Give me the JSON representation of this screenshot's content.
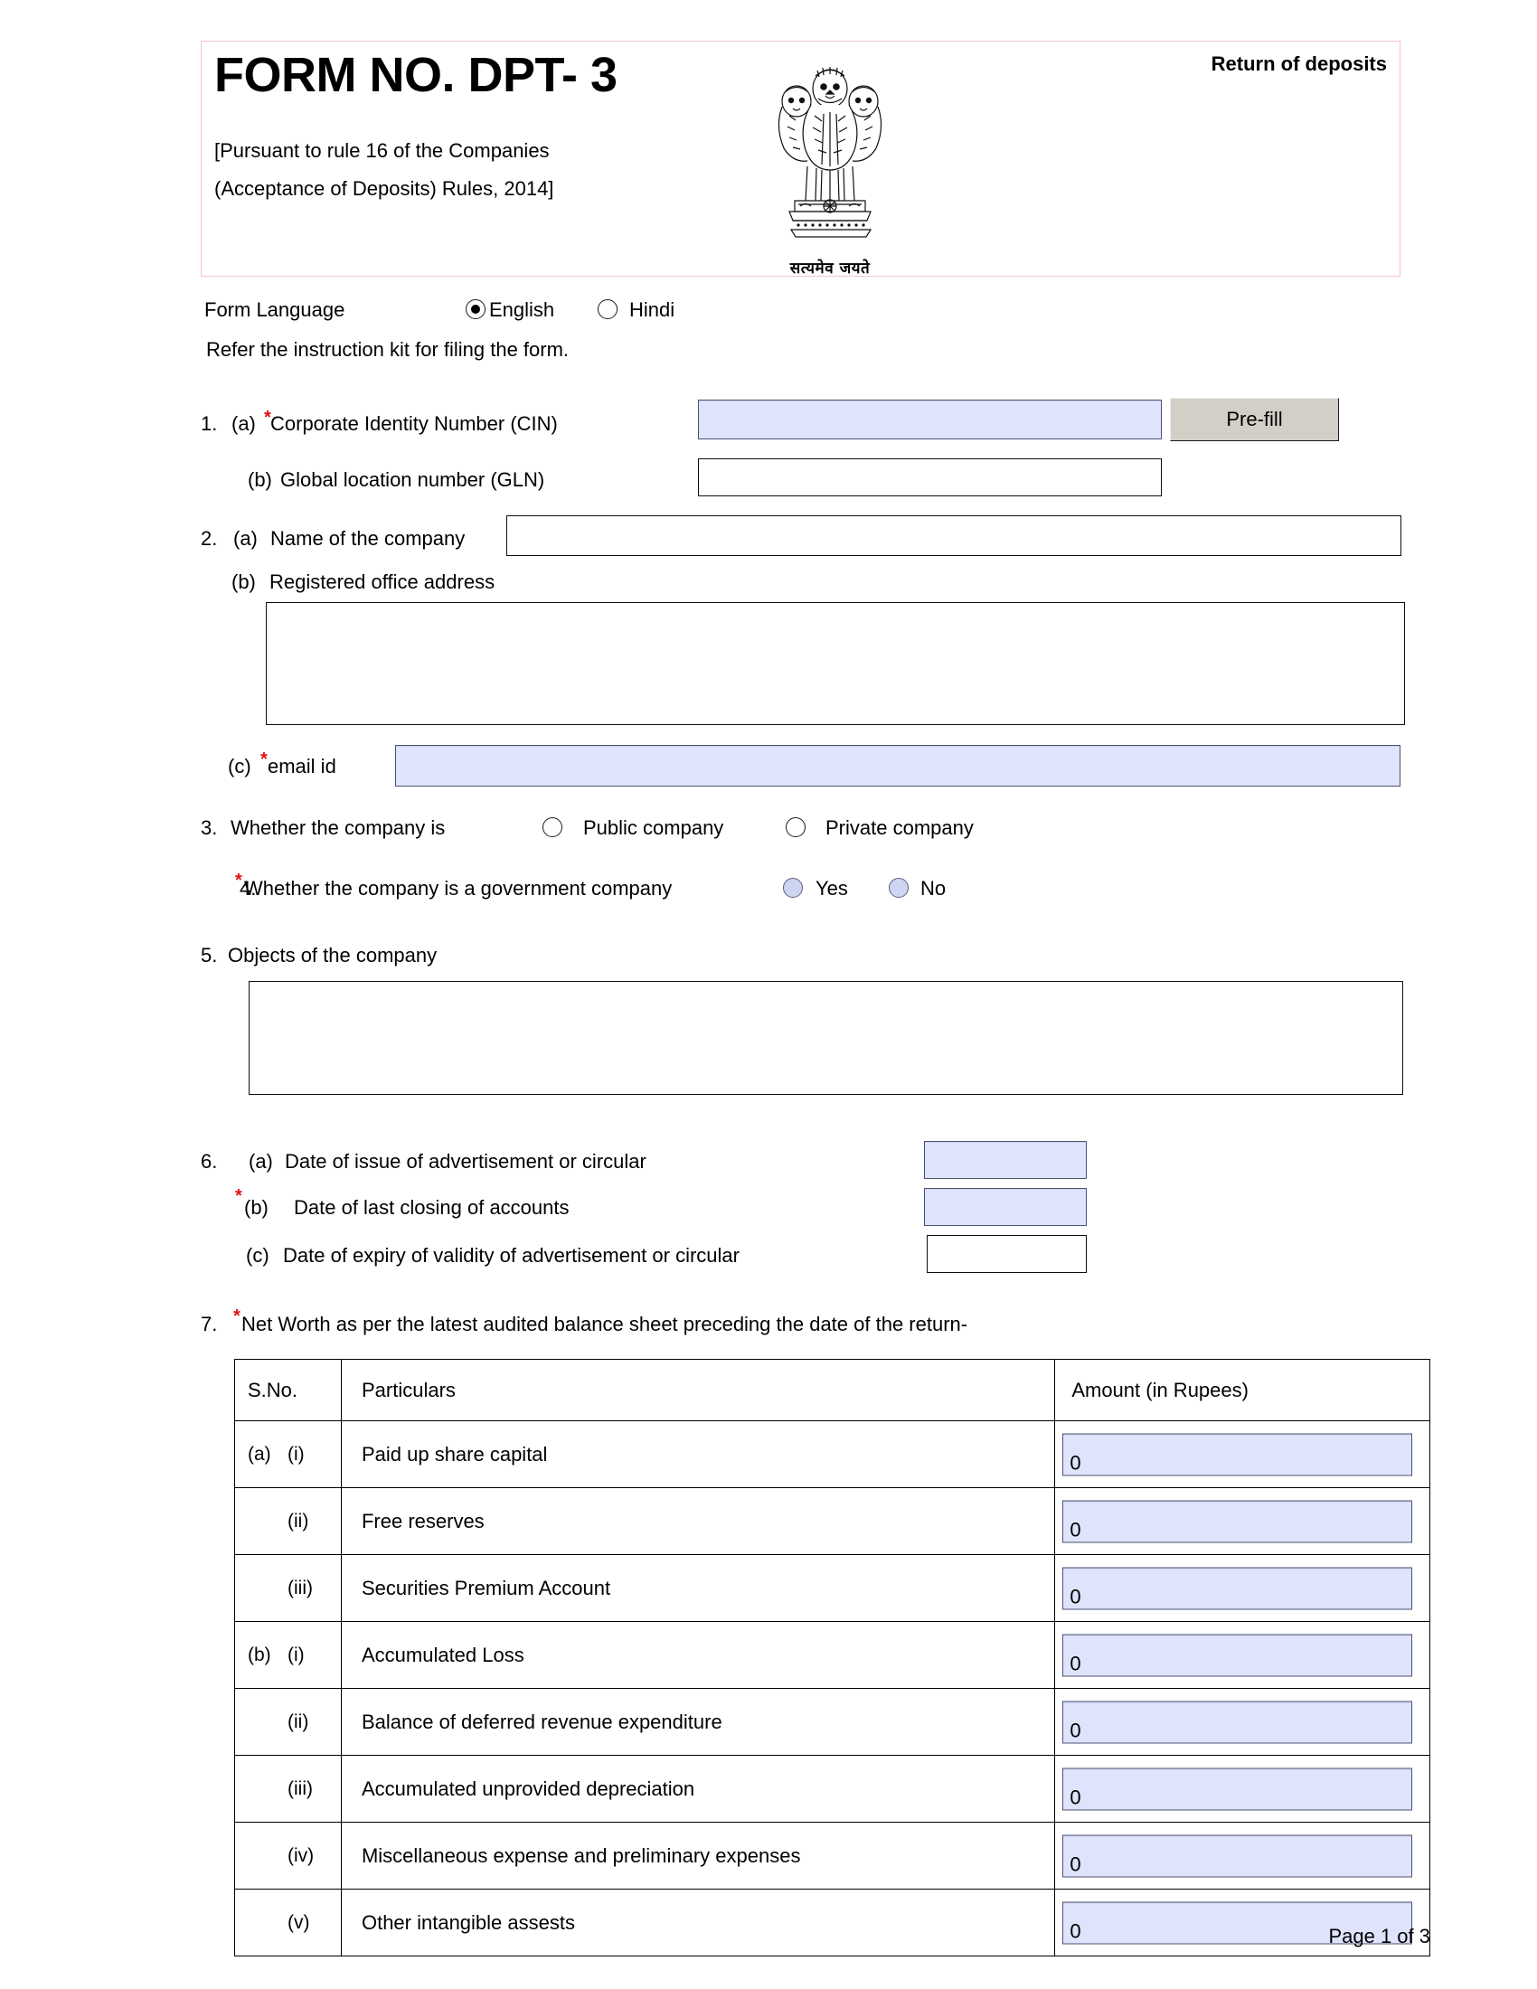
{
  "header": {
    "title": "FORM NO. DPT- 3",
    "rule_line_1": "[Pursuant to rule 16 of the Companies",
    "rule_line_2": "(Acceptance of Deposits) Rules, 2014]",
    "return_label": "Return of deposits",
    "emblem_motto": "सत्यमेव जयते"
  },
  "form_language": {
    "label": "Form Language",
    "option_english": "English",
    "option_hindi": "Hindi",
    "selected": "English",
    "instruction": "Refer the instruction kit for filing the form."
  },
  "item1": {
    "number": "1.",
    "a_prefix": "(a)",
    "a_label": "Corporate Identity Number (CIN)",
    "a_value": "",
    "b_prefix": "(b)",
    "b_label": "Global location number (GLN)",
    "b_value": "",
    "prefill_button": "Pre-fill"
  },
  "item2": {
    "number": "2.",
    "a_prefix": "(a)",
    "a_label": "Name of the company",
    "a_value": "",
    "b_prefix": "(b)",
    "b_label": "Registered office address",
    "b_value": "",
    "c_prefix": "(c)",
    "c_label": "email id",
    "c_value": ""
  },
  "item3": {
    "number": "3.",
    "label": "Whether the company is",
    "option_public": "Public company",
    "option_private": "Private company",
    "selected": ""
  },
  "item4": {
    "number": "4.",
    "label": "Whether the company is a government company",
    "option_yes": "Yes",
    "option_no": "No",
    "selected": ""
  },
  "item5": {
    "number": "5.",
    "label": "Objects of the company",
    "value": ""
  },
  "item6": {
    "number": "6.",
    "a_prefix": "(a)",
    "a_label": "Date of issue of advertisement or circular",
    "a_value": "",
    "b_prefix": "(b)",
    "b_label": "Date of last closing of accounts",
    "b_value": "",
    "c_prefix": "(c)",
    "c_label": "Date of expiry of validity of advertisement or circular",
    "c_value": ""
  },
  "item7": {
    "number": "7.",
    "label": "Net Worth as per the latest audited balance sheet preceding the date of the return-",
    "columns": {
      "sno": "S.No.",
      "particulars": "Particulars",
      "amount": "Amount (in Rupees)"
    },
    "rows": [
      {
        "group": "(a)",
        "roman": "(i)",
        "particulars": "Paid up share capital",
        "amount": "0"
      },
      {
        "group": "",
        "roman": "(ii)",
        "particulars": "Free reserves",
        "amount": "0"
      },
      {
        "group": "",
        "roman": "(iii)",
        "particulars": "Securities Premium Account",
        "amount": "0"
      },
      {
        "group": "(b)",
        "roman": "(i)",
        "particulars": "Accumulated Loss",
        "amount": "0"
      },
      {
        "group": "",
        "roman": "(ii)",
        "particulars": "Balance of deferred revenue expenditure",
        "amount": "0"
      },
      {
        "group": "",
        "roman": "(iii)",
        "particulars": "Accumulated unprovided depreciation",
        "amount": "0"
      },
      {
        "group": "",
        "roman": "(iv)",
        "particulars": "Miscellaneous expense and preliminary expenses",
        "amount": "0"
      },
      {
        "group": "",
        "roman": "(v)",
        "particulars": "Other intangible assests",
        "amount": "0"
      }
    ]
  },
  "footer": {
    "page_label": "Page 1 of 3"
  },
  "colors": {
    "required_field_fill": "#dfe3fb",
    "required_field_border": "#4b5370",
    "header_border": "#f2c4cf",
    "prefill_button": "#d2cfc7",
    "asterisk": "#e01010"
  }
}
